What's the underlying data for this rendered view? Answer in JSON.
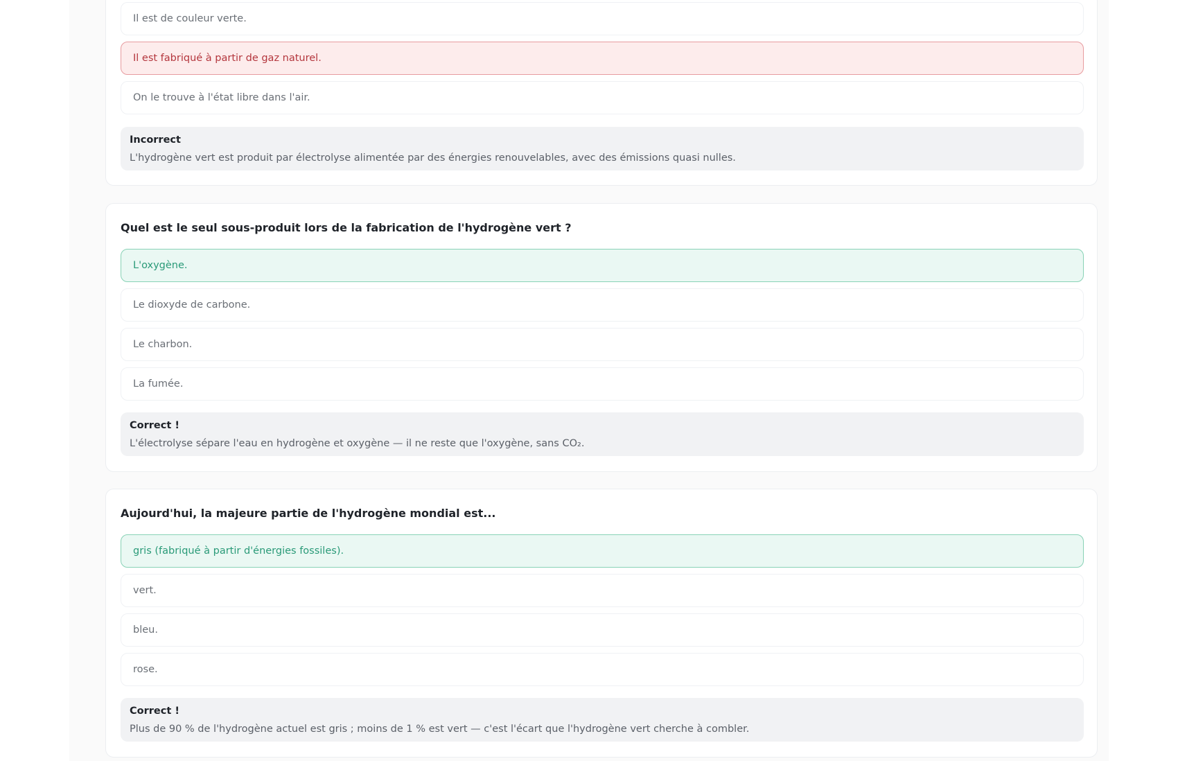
{
  "quiz": {
    "q1": {
      "options": [
        "Il est de couleur verte.",
        "Il est fabriqué à partir de gaz naturel.",
        "On le trouve à l'état libre dans l'air."
      ],
      "feedback_title": "Incorrect",
      "feedback_text": "L'hydrogène vert est produit par électrolyse alimentée par des énergies renouvelables, avec des émissions quasi nulles."
    },
    "q2": {
      "question": "Quel est le seul sous-produit lors de la fabrication de l'hydrogène vert ?",
      "options": [
        "L'oxygène.",
        "Le dioxyde de carbone.",
        "Le charbon.",
        "La fumée."
      ],
      "feedback_title": "Correct !",
      "feedback_text": "L'électrolyse sépare l'eau en hydrogène et oxygène — il ne reste que l'oxygène, sans CO₂."
    },
    "q3": {
      "question": "Aujourd'hui, la majeure partie de l'hydrogène mondial est...",
      "options": [
        "gris (fabriqué à partir d'énergies fossiles).",
        "vert.",
        "bleu.",
        "rose."
      ],
      "feedback_title": "Correct !",
      "feedback_text": "Plus de 90 % de l'hydrogène actuel est gris ; moins de 1 % est vert — c'est l'écart que l'hydrogène vert cherche à combler."
    }
  },
  "colors": {
    "wrong_bg": "#fdecec",
    "wrong_border": "#e79b9f",
    "wrong_text": "#b4363d",
    "right_bg": "#eaf8f3",
    "right_border": "#88d2b6",
    "right_text": "#2a9a78",
    "feedback_bg": "#f1f2f4"
  }
}
